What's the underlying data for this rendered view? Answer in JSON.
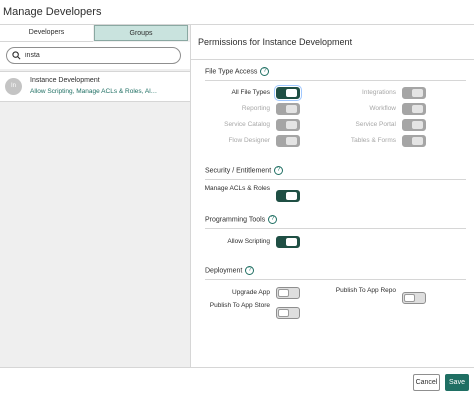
{
  "dialog": {
    "title": "Manage Developers"
  },
  "tabs": [
    {
      "label": "Developers"
    },
    {
      "label": "Groups",
      "active": true
    }
  ],
  "search": {
    "value": "insta"
  },
  "list": [
    {
      "initials": "In",
      "name": "Instance Development",
      "subtitle": "Allow Scripting, Manage ACLs & Roles, Al…"
    }
  ],
  "permissions": {
    "title": "Permissions for Instance Development",
    "file_type_access": {
      "heading": "File Type Access",
      "items": [
        {
          "label": "All File Types",
          "state": "on"
        },
        {
          "label": "Integrations",
          "state": "disabled-on"
        },
        {
          "label": "Reporting",
          "state": "disabled-on"
        },
        {
          "label": "Workflow",
          "state": "disabled-on"
        },
        {
          "label": "Service Catalog",
          "state": "disabled-on"
        },
        {
          "label": "Service Portal",
          "state": "disabled-on"
        },
        {
          "label": "Flow Designer",
          "state": "disabled-on"
        },
        {
          "label": "Tables & Forms",
          "state": "disabled-on"
        }
      ]
    },
    "security": {
      "heading": "Security / Entitlement",
      "items": [
        {
          "label": "Manage ACLs & Roles",
          "state": "on"
        }
      ]
    },
    "programming": {
      "heading": "Programming Tools",
      "items": [
        {
          "label": "Allow Scripting",
          "state": "on"
        }
      ]
    },
    "deployment": {
      "heading": "Deployment",
      "items": [
        {
          "label": "Upgrade App",
          "state": "off"
        },
        {
          "label": "Publish To App Repo",
          "state": "off"
        },
        {
          "label": "Publish To App Store",
          "state": "off"
        }
      ]
    }
  },
  "help_glyph": "?",
  "footer": {
    "cancel": "Cancel",
    "save": "Save"
  },
  "colors": {
    "accent": "#1f6f63",
    "toggle_on": "#1f4f44",
    "tab_active": "#c9e3de"
  }
}
